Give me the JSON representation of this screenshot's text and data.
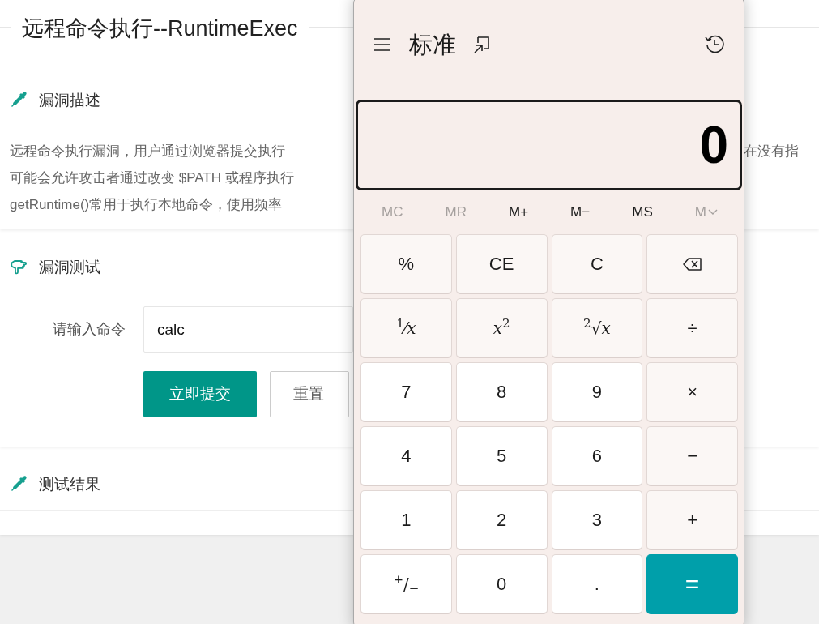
{
  "page": {
    "title": "远程命令执行--RuntimeExec",
    "sections": [
      {
        "kind": "description",
        "title": "漏洞描述",
        "lines": [
          {
            "left": "远程命令执行漏洞，用户通过浏览器提交执行",
            "right": "在没有指"
          },
          {
            "left": "可能会允许攻击者通过改变 $PATH 或程序执行"
          },
          {
            "left": "getRuntime()常用于执行本地命令，使用频率"
          }
        ]
      },
      {
        "kind": "form",
        "title": "漏洞测试",
        "field": {
          "label": "请输入命令",
          "value": "calc"
        },
        "buttons": [
          {
            "label": "立即提交",
            "primary": true
          },
          {
            "label": "重置",
            "primary": false
          }
        ]
      },
      {
        "kind": "result",
        "title": "测试结果"
      }
    ]
  },
  "calculator": {
    "mode": "标准",
    "display": "0",
    "memory": [
      {
        "label": "MC",
        "disabled": true,
        "kind": "plain"
      },
      {
        "label": "MR",
        "disabled": true,
        "kind": "plain"
      },
      {
        "label": "M+",
        "disabled": false,
        "kind": "plain"
      },
      {
        "label": "M−",
        "disabled": false,
        "kind": "plain"
      },
      {
        "label": "MS",
        "disabled": false,
        "kind": "plain"
      },
      {
        "label": "M",
        "disabled": true,
        "kind": "menu"
      }
    ],
    "keys": [
      {
        "label": "%",
        "kind": "fn"
      },
      {
        "label": "CE",
        "kind": "fn"
      },
      {
        "label": "C",
        "kind": "fn"
      },
      {
        "kind": "backspace"
      },
      {
        "label": "$^{1}$⁄*x*",
        "kind": "fn"
      },
      {
        "label": "*x*$^{2}$",
        "kind": "fn"
      },
      {
        "label": "$^{2}$√*x*",
        "kind": "fn"
      },
      {
        "label": "÷",
        "kind": "fn"
      },
      {
        "label": "7",
        "kind": "digit"
      },
      {
        "label": "8",
        "kind": "digit"
      },
      {
        "label": "9",
        "kind": "digit"
      },
      {
        "label": "×",
        "kind": "fn"
      },
      {
        "label": "4",
        "kind": "digit"
      },
      {
        "label": "5",
        "kind": "digit"
      },
      {
        "label": "6",
        "kind": "digit"
      },
      {
        "label": "−",
        "kind": "fn"
      },
      {
        "label": "1",
        "kind": "digit"
      },
      {
        "label": "2",
        "kind": "digit"
      },
      {
        "label": "3",
        "kind": "digit"
      },
      {
        "label": "+",
        "kind": "fn"
      },
      {
        "label": "$^{+}$/$_{−}$",
        "kind": "digit"
      },
      {
        "label": "0",
        "kind": "digit"
      },
      {
        "label": ".",
        "kind": "digit"
      },
      {
        "label": "=",
        "kind": "equals"
      }
    ]
  }
}
